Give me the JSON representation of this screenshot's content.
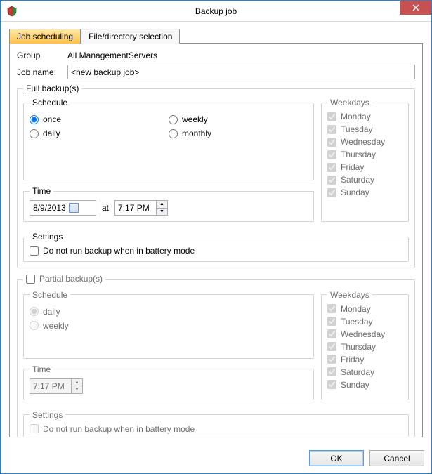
{
  "window": {
    "title": "Backup job"
  },
  "tabs": {
    "scheduling": "Job scheduling",
    "files": "File/directory selection"
  },
  "header": {
    "group_label": "Group",
    "group_value": "All ManagementServers",
    "jobname_label": "Job name:",
    "jobname_value": "<new backup job>"
  },
  "full": {
    "legend": "Full backup(s)",
    "schedule_legend": "Schedule",
    "opts": {
      "once": "once",
      "daily": "daily",
      "weekly": "weekly",
      "monthly": "monthly"
    },
    "time_legend": "Time",
    "date": "8/9/2013",
    "at": "at",
    "time": "7:17 PM",
    "settings_legend": "Settings",
    "battery": "Do not run backup when in battery mode"
  },
  "partial": {
    "legend": "Partial backup(s)",
    "schedule_legend": "Schedule",
    "opts": {
      "daily": "daily",
      "weekly": "weekly"
    },
    "time_legend": "Time",
    "time": "7:17 PM",
    "settings_legend": "Settings",
    "battery": "Do not run backup when in battery mode"
  },
  "weekdays": {
    "legend": "Weekdays",
    "days": [
      "Monday",
      "Tuesday",
      "Wednesday",
      "Thursday",
      "Friday",
      "Saturday",
      "Sunday"
    ]
  },
  "buttons": {
    "ok": "OK",
    "cancel": "Cancel"
  }
}
